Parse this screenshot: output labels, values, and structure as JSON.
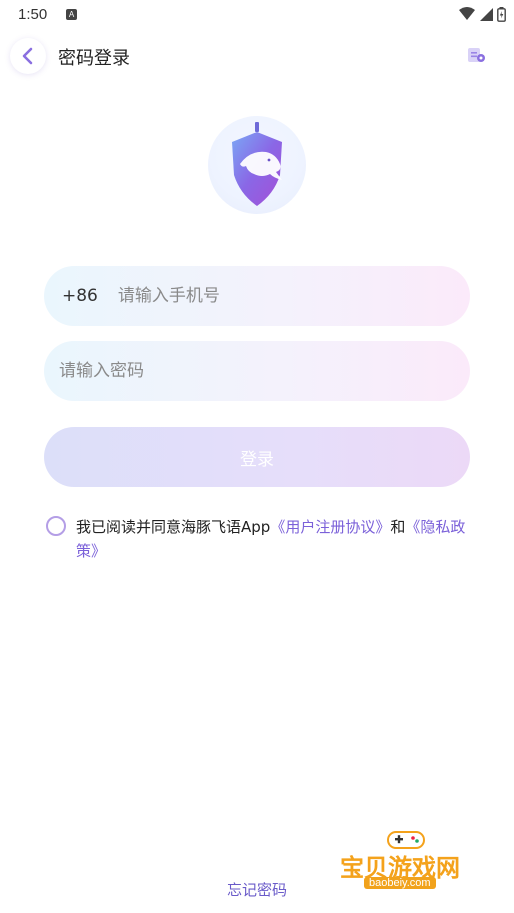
{
  "status_bar": {
    "time": "1:50",
    "notification_badge": "A"
  },
  "header": {
    "title": "密码登录",
    "back_icon": "chevron-left-icon",
    "service_icon": "customer-service-icon"
  },
  "logo": {
    "icon": "dolphin-shield-logo"
  },
  "form": {
    "country_code": "+86",
    "phone_placeholder": "请输入手机号",
    "password_placeholder": "请输入密码",
    "login_label": "登录"
  },
  "agreement": {
    "prefix": "我已阅读并同意海豚飞语App",
    "user_agreement": "《用户注册协议》",
    "conjunction": "和",
    "privacy_policy": "《隐私政策》"
  },
  "footer": {
    "forgot_password": "忘记密码"
  },
  "watermark": {
    "main": "宝贝游戏网",
    "sub": "baobeiy.com"
  },
  "colors": {
    "accent": "#7b61d9",
    "radio_border": "#b49ee6",
    "watermark": "#f4a21b"
  }
}
